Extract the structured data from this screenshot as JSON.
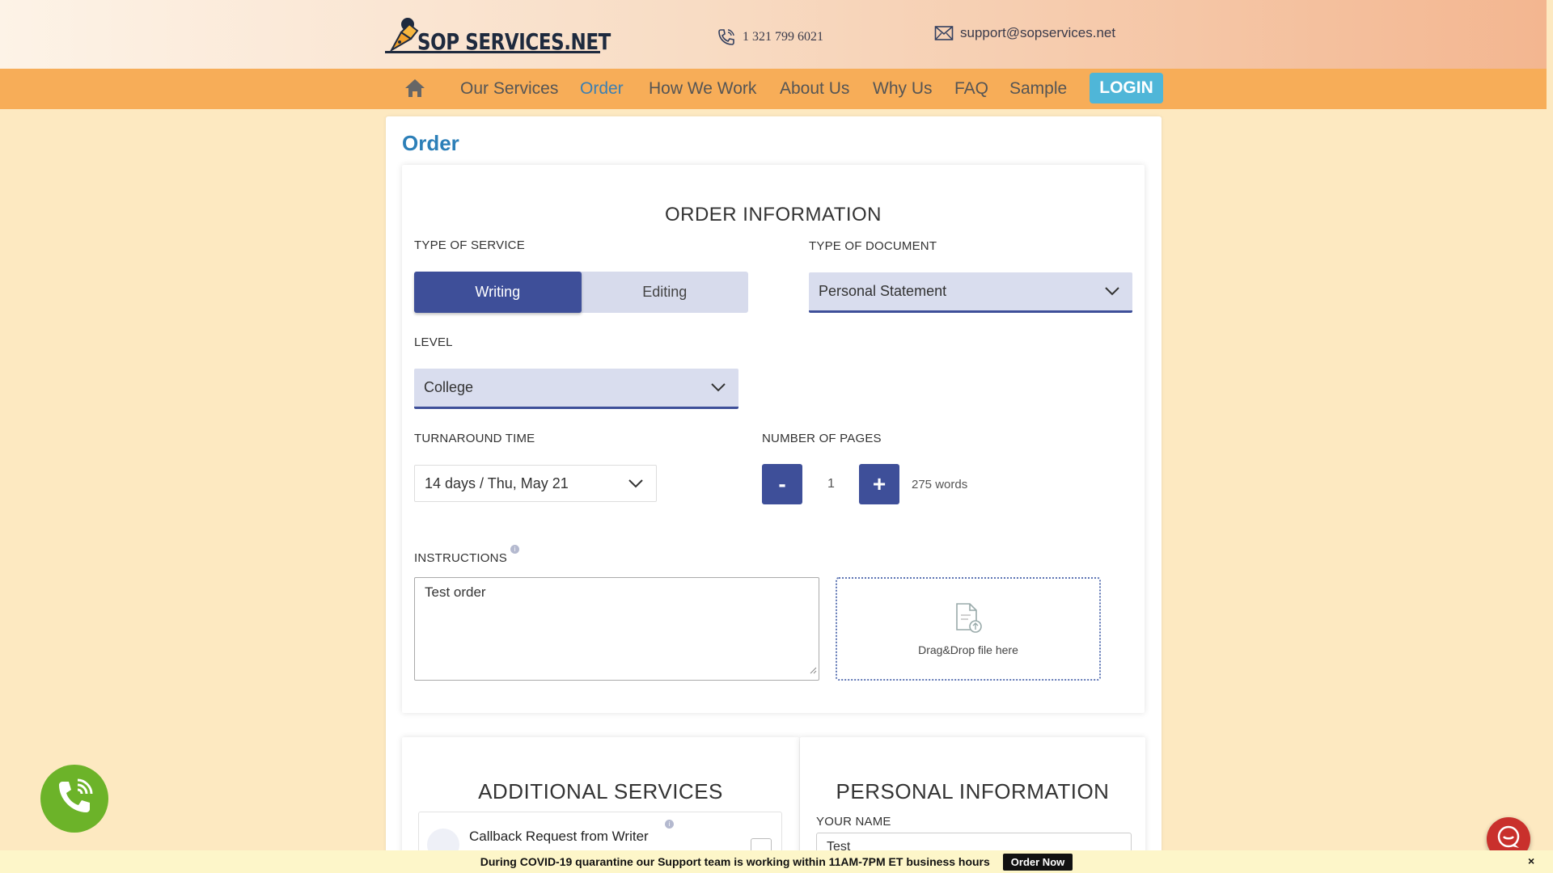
{
  "header": {
    "logo_text": "SOP SERVICES.NET",
    "phone": "1 321 799 6021",
    "email": "support@sopservices.net"
  },
  "nav": {
    "items": [
      {
        "label": "Our Services",
        "active": false
      },
      {
        "label": "Order",
        "active": true
      },
      {
        "label": "How We Work",
        "active": false
      },
      {
        "label": "About Us",
        "active": false
      },
      {
        "label": "Why Us",
        "active": false
      },
      {
        "label": "FAQ",
        "active": false
      },
      {
        "label": "Sample",
        "active": false
      }
    ],
    "login_label": "LOGIN"
  },
  "page": {
    "title": "Order"
  },
  "order_info": {
    "title": "ORDER INFORMATION",
    "type_of_service": {
      "label": "TYPE OF SERVICE",
      "options": [
        "Writing",
        "Editing"
      ],
      "selected": "Writing"
    },
    "type_of_document": {
      "label": "TYPE OF DOCUMENT",
      "value": "Personal Statement"
    },
    "level": {
      "label": "LEVEL",
      "value": "College"
    },
    "turnaround": {
      "label": "TURNAROUND TIME",
      "value": "14 days / Thu, May 21"
    },
    "pages": {
      "label": "NUMBER OF PAGES",
      "minus": "-",
      "plus": "+",
      "value": "1",
      "words": "275 words"
    },
    "instructions": {
      "label": "INSTRUCTIONS",
      "value": "Test order",
      "info_glyph": "i"
    },
    "dropzone": {
      "text": "Drag&Drop file here"
    }
  },
  "additional_services": {
    "title": "ADDITIONAL SERVICES",
    "option_label": "Callback Request from Writer"
  },
  "personal_info": {
    "title": "PERSONAL INFORMATION",
    "name_label": "YOUR NAME",
    "name_value": "Test"
  },
  "banner": {
    "text": "During COVID-19 quarantine our Support team is working within 11AM-7PM ET business hours",
    "button": "Order Now",
    "close": "×"
  },
  "colors": {
    "accent": "#3e4f99",
    "nav_bg": "#f7ad58",
    "page_bg": "#fde9c1",
    "link": "#2c7fb8",
    "login": "#4fb6d8",
    "call": "#6cb329",
    "chat": "#c9302c"
  },
  "icons": [
    "logo-pen-icon",
    "phone-icon",
    "mail-icon",
    "home-icon",
    "chevron-down-icon",
    "info-icon",
    "file-upload-icon",
    "phone-call-icon",
    "chat-icon",
    "close-icon"
  ]
}
